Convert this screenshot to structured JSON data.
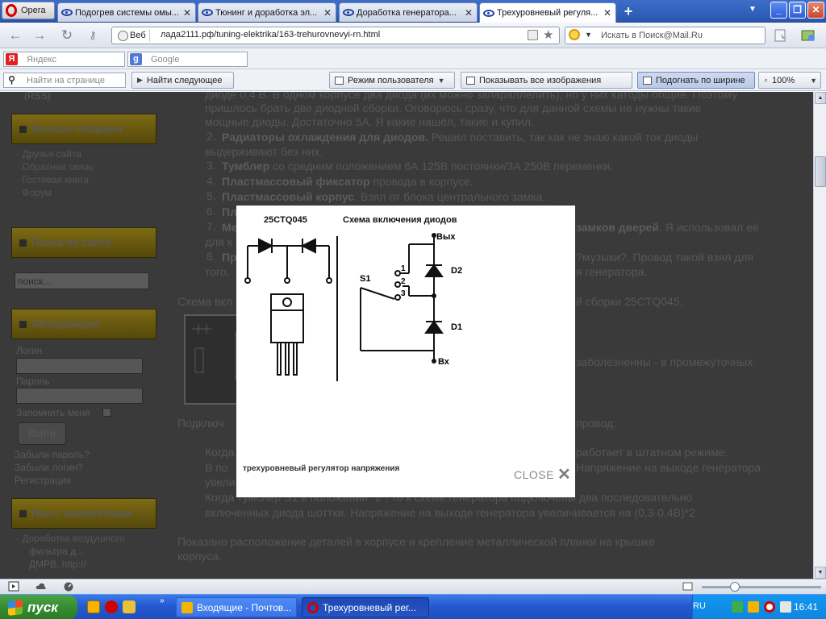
{
  "browser": {
    "menu_label": "Opera",
    "tabs": [
      {
        "label": "Подогрев системы омы..."
      },
      {
        "label": "Тюнинг и доработка эл..."
      },
      {
        "label": "Доработка генератора..."
      },
      {
        "label": "Трехуровневый регуля..."
      }
    ],
    "new_tab_label": "+",
    "address": {
      "web_badge": "Веб",
      "url": "лада2111.рф/tuning-elektrika/163-trehurovnevyi-rn.html"
    },
    "search_placeholder": "Искать в Поиск@Mail.Ru",
    "yandex_placeholder": "Яндекс",
    "google_placeholder": "Google",
    "find_placeholder": "Найти на странице",
    "find_next_label": "Найти следующее",
    "mode_label": "Режим пользователя",
    "show_images_label": "Показывать все изображения",
    "fit_width_label": "Подогнать по ширине",
    "zoom_value": "100%"
  },
  "sidebar": {
    "rss": "(RSS)",
    "more_title": "Больше общения",
    "more_links": [
      "Друзья сайта",
      "Обратная связь",
      "Гостевая книга",
      "Форум"
    ],
    "search_title": "Поиск по сайту",
    "search_value": "поиск...",
    "auth_title": "Авторизация",
    "login_label": "Логин",
    "password_label": "Пароль",
    "remember_label": "Запомнить меня",
    "login_button": "Войти",
    "auth_links": [
      "Забыли пароль?",
      "Забыли логин?",
      "Регистрация"
    ],
    "comments_title": "Посл. комментарии",
    "comment_lines": [
      "Доработка воздушного",
      "фильтра д...",
      "ДМРВ. http://"
    ]
  },
  "article": {
    "lines": [
      "диоде 0,4 В. В одном корпусе два диода (их можно запараллелить), но у них катоды общие. Поэтому",
      "пришлось брать две диодной сборки. Оговорюсь сразу, что для данной схемы не нужны такие",
      "мощные диоды. Достаточно 5А. Я какие нашёл, такие и купил."
    ],
    "item2_bold": "Радиаторы охлаждения для диодов.",
    "item2_rest": " Решил поставить, так как не знаю какой ток диоды",
    "item2_cont": "выдерживают без них.",
    "item3_bold": "Тумблер",
    "item3_rest": " со средним положением 6А 125В постоянки/3А 250В переменки.",
    "item4_bold": "Пластмассовый фиксатор",
    "item4_rest": " провода в корпусе.",
    "item5_bold": "Пластмассовый корпус",
    "item5_rest": ". Взял от блока центрального замка.",
    "item6_frag": "Пл",
    "item7_frag": "Ме",
    "item7_right_bold": "замков дверей",
    "item7_right_rest": ". Я использовал её",
    "item7_cont": "для к",
    "item8_frag": "Пр",
    "item8_right": "?музыки?. Провод такой взял для",
    "item8_cont": "того,",
    "item8_right_cont": "я генератора.",
    "scheme_left": "Схема вкл",
    "scheme_right": "й сборки 25CTQ045.",
    "right_mid": "заболезненны - в промежуточных",
    "connect_left": "Подключ",
    "connect_right": "провод.",
    "when1_left": "Когда",
    "when1_right": "работает в штатном режиме.",
    "when2_left": "В по",
    "when2_right": "Напряжение на выходе генератора",
    "when2_cont": "увели",
    "when3": "Когда тумблер S1 в положении \"2\", то к схеме генератора подключены два последовательно",
    "when4": "включенных диода шоттки. Напряжение на выходе генератора увеличивается на (0,3-0,4В)*2",
    "shown1": "Показано расположение деталей в корпусе и крепление металлической планки на крышке",
    "shown2": "корпуса.",
    "nums": [
      "2.",
      "3.",
      "4.",
      "5.",
      "6.",
      "7.",
      "8."
    ]
  },
  "lightbox": {
    "title_left": "25CTQ045",
    "title_right": "Схема включения диодов",
    "labels": {
      "out": "Вых",
      "in": "Вх",
      "s1": "S1",
      "d1": "D1",
      "d2": "D2",
      "p1": "1",
      "p2": "2",
      "p3": "3"
    },
    "caption": "трехуровневый регулятор напряжения",
    "close_label": "CLOSE"
  },
  "taskbar": {
    "start_label": "пуск",
    "tasks": [
      "Входящие - Почтов...",
      "Трехуровневый рег..."
    ],
    "lang": "RU",
    "clock": "16:41"
  }
}
